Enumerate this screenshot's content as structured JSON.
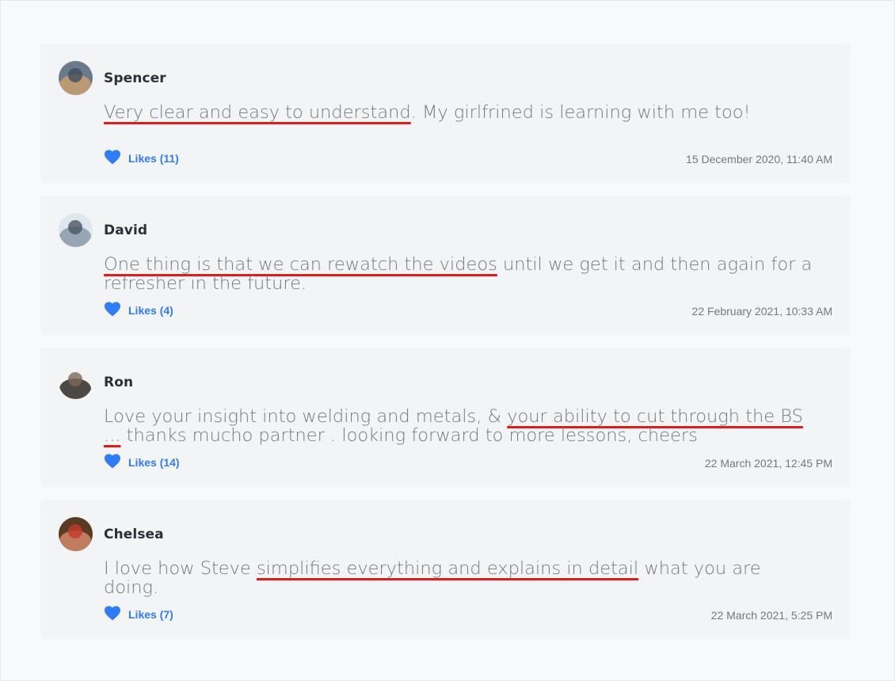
{
  "comments": [
    {
      "name": "Spencer",
      "text_parts": [
        {
          "t": "Very clear and easy to understand",
          "hl": true
        },
        {
          "t": ". My girlfrined is learning with me too!",
          "hl": false
        }
      ],
      "likes": "Likes (11)",
      "date": "15 December 2020, 11:40 AM",
      "avatar_colors": [
        "#6b7a8a",
        "#c8a070",
        "#3f4d5e"
      ]
    },
    {
      "name": "David",
      "text_parts": [
        {
          "t": "One thing is that we can rewatch the videos",
          "hl": true
        },
        {
          "t": " until we get it and then again for a refresher in the future.",
          "hl": false
        }
      ],
      "likes": "Likes (4)",
      "date": "22 February 2021, 10:33 AM",
      "avatar_colors": [
        "#dfe6ee",
        "#8c9aa8",
        "#4b5662"
      ]
    },
    {
      "name": "Ron",
      "text_parts": [
        {
          "t": "Love your insight into welding and metals, & ",
          "hl": false
        },
        {
          "t": "your ability to cut through the BS ...",
          "hl": true
        },
        {
          "t": " thanks mucho partner . looking forward to more lessons, cheers",
          "hl": false
        }
      ],
      "likes": "Likes (14)",
      "date": "22 March 2021, 12:45 PM",
      "avatar_colors": [
        "#f4f4f4",
        "#2e2a26",
        "#7b6a58"
      ]
    },
    {
      "name": "Chelsea",
      "text_parts": [
        {
          "t": "I love how Steve ",
          "hl": false
        },
        {
          "t": "simplifies everything and explains in detail",
          "hl": true
        },
        {
          "t": " what you are doing.",
          "hl": false
        }
      ],
      "likes": "Likes (7)",
      "date": "22 March 2021, 5:25 PM",
      "avatar_colors": [
        "#5a3a22",
        "#d4886a",
        "#c23b2a"
      ]
    }
  ],
  "colors": {
    "accent": "#2f7cf5",
    "underline": "#e31b1b",
    "card_bg": "#f3f4f6",
    "page_bg": "#f8f9fa"
  },
  "icons": {
    "like": "heart-icon"
  }
}
